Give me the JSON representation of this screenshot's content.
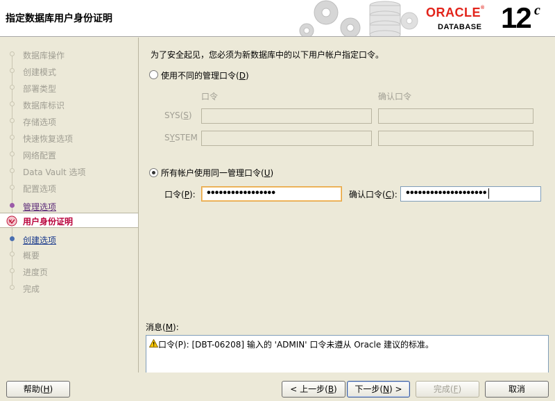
{
  "header": {
    "title": "指定数据库用户身份证明",
    "logo_text": "ORACLE",
    "logo_reg": "®",
    "logo_sub": "DATABASE",
    "version": "12",
    "version_sup": "c"
  },
  "sidebar": {
    "steps": [
      {
        "label": "数据库操作"
      },
      {
        "label": "创建模式"
      },
      {
        "label": "部署类型"
      },
      {
        "label": "数据库标识"
      },
      {
        "label": "存储选项"
      },
      {
        "label": "快速恢复选项"
      },
      {
        "label": "网络配置"
      },
      {
        "label": "Data Vault 选项"
      },
      {
        "label": "配置选项"
      },
      {
        "label": "管理选项"
      },
      {
        "label": "用户身份证明"
      },
      {
        "label": "创建选项"
      },
      {
        "label": "概要"
      },
      {
        "label": "进度页"
      },
      {
        "label": "完成"
      }
    ]
  },
  "main": {
    "intro": "为了安全起见，您必须为新数据库中的以下用户帐户指定口令。",
    "option_different": {
      "label": "使用不同的管理口令(",
      "mnemonic": "D",
      "suffix": ")",
      "checked": false
    },
    "col_password": "口令",
    "col_confirm": "确认口令",
    "row_sys": {
      "label": "SYS(",
      "mnemonic": "S",
      "suffix": ")"
    },
    "row_system": {
      "label_a": "S",
      "mnemonic": "Y",
      "label_b": "STEM"
    },
    "option_same": {
      "label": "所有帐户使用同一管理口令(",
      "mnemonic": "U",
      "suffix": ")",
      "checked": true
    },
    "password": {
      "label": "口令(",
      "mnemonic": "P",
      "suffix": "):",
      "value": "•••••••••••••••••"
    },
    "confirm": {
      "label": "确认口令(",
      "mnemonic": "C",
      "suffix": "):",
      "value": "••••••••••••••••••••"
    },
    "messages": {
      "label": "消息(",
      "mnemonic": "M",
      "suffix": "):",
      "text": "口令(P): [DBT-06208] 输入的 'ADMIN' 口令未遵从 Oracle 建议的标准。"
    }
  },
  "footer": {
    "help": {
      "label": "帮助(",
      "mnemonic": "H",
      "suffix": ")"
    },
    "back": {
      "label": "< 上一步(",
      "mnemonic": "B",
      "suffix": ")"
    },
    "next": {
      "label": "下一步(",
      "mnemonic": "N",
      "suffix": ") >"
    },
    "finish": {
      "label": "完成(",
      "mnemonic": "F",
      "suffix": ")"
    },
    "cancel": {
      "label": "取消"
    }
  },
  "colors": {
    "oracle_red": "#e2231a",
    "current_step": "#b8003a",
    "link_step": "#1a3a8c",
    "visited_step": "#5c2a78"
  }
}
